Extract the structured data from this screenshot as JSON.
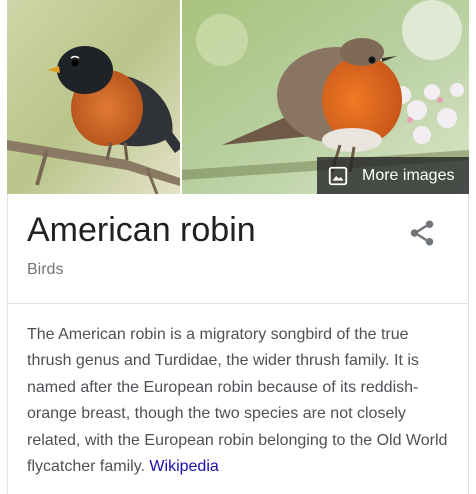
{
  "images": {
    "more_images_label": "More images"
  },
  "entity": {
    "title": "American robin",
    "subtitle": "Birds"
  },
  "description": {
    "text": "The American robin is a migratory songbird of the true thrush genus and Turdidae, the wider thrush family. It is named after the European robin because of its reddish-orange breast, though the two species are not closely related, with the European robin belonging to the Old World flycatcher family.",
    "source_link": "Wikipedia"
  },
  "colors": {
    "link": "#1a0dab",
    "title": "#202124",
    "subtitle": "#70757a",
    "body": "#4d5156"
  }
}
